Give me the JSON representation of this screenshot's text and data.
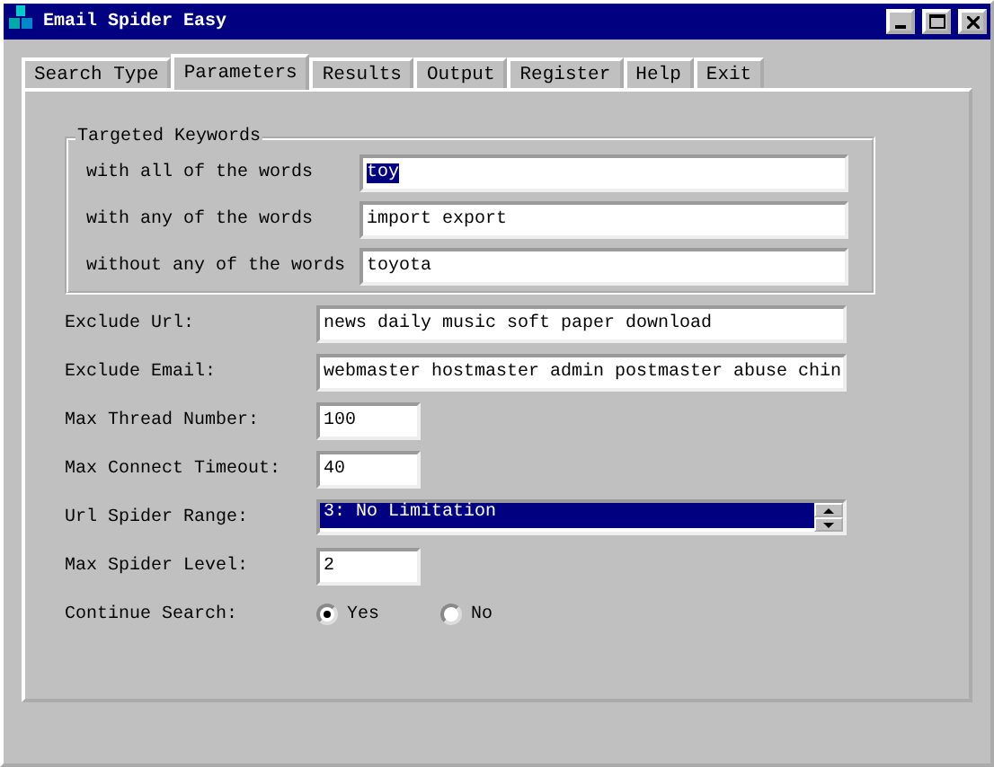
{
  "window": {
    "title": "Email Spider Easy"
  },
  "tabs": [
    {
      "label": "Search Type",
      "selected": false
    },
    {
      "label": "Parameters",
      "selected": true
    },
    {
      "label": "Results",
      "selected": false
    },
    {
      "label": "Output",
      "selected": false
    },
    {
      "label": "Register",
      "selected": false
    },
    {
      "label": "Help",
      "selected": false
    },
    {
      "label": "Exit",
      "selected": false
    }
  ],
  "keywords": {
    "title": "Targeted Keywords",
    "fields": [
      {
        "label": "with all of the words",
        "value": "toy",
        "text_selected": true
      },
      {
        "label": "with any of the words",
        "value": "import export",
        "text_selected": false
      },
      {
        "label": "without any of the words",
        "value": "toyota",
        "text_selected": false
      }
    ]
  },
  "params": [
    {
      "kind": "wide",
      "label": "Exclude Url:",
      "value": "news daily music soft paper download"
    },
    {
      "kind": "wide",
      "label": "Exclude Email:",
      "value": "webmaster hostmaster admin postmaster abuse chin"
    },
    {
      "kind": "short",
      "label": "Max Thread Number:",
      "value": "100"
    },
    {
      "kind": "short",
      "label": "Max Connect Timeout:",
      "value": "40"
    },
    {
      "kind": "list",
      "label": "Url Spider Range:",
      "items": [
        {
          "label": "3: No Limitation",
          "selected": true
        }
      ]
    },
    {
      "kind": "short",
      "label": "Max Spider Level:",
      "value": "2"
    },
    {
      "kind": "radio",
      "label": "Continue Search:",
      "options": [
        {
          "label": "Yes",
          "selected": true
        },
        {
          "label": "No",
          "selected": false
        }
      ]
    }
  ]
}
